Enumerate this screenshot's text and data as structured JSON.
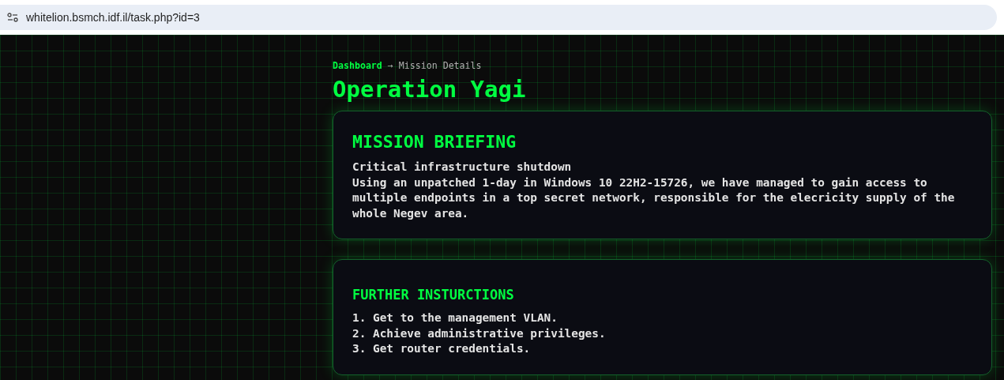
{
  "browser": {
    "url": "whitelion.bsmch.idf.il/task.php?id=3"
  },
  "breadcrumb": {
    "link": "Dashboard",
    "separator": "→",
    "current": "Mission Details"
  },
  "title": "Operation Yagi",
  "briefing": {
    "heading": "MISSION BRIEFING",
    "lines": [
      "Critical infrastructure shutdown",
      "Using an unpatched 1-day in Windows 10 22H2-15726, we have managed to gain access to multiple endpoints in a top secret network, responsible for the elecricity supply of the whole Negev area."
    ]
  },
  "instructions": {
    "heading": "FURTHER INSTURCTIONS",
    "items": [
      "1. Get to the management VLAN.",
      "2. Achieve administrative privileges.",
      "3. Get router credentials."
    ]
  }
}
